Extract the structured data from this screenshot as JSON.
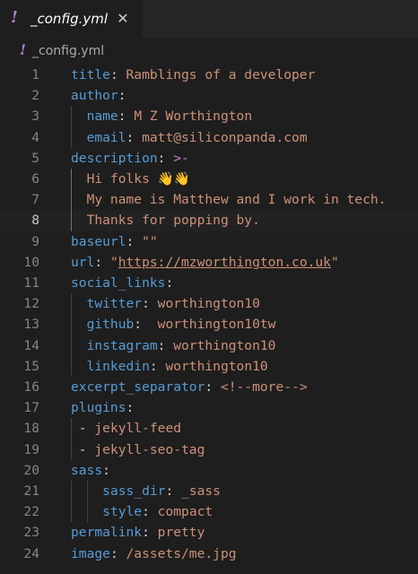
{
  "tab": {
    "icon": "!",
    "title": "_config.yml",
    "close": "✕"
  },
  "breadcrumb": {
    "icon": "!",
    "label": "_config.yml"
  },
  "colors": {
    "key": "#569cd6",
    "string": "#ce9178",
    "plain": "#d4d4d4",
    "operator": "#c586c0",
    "line_number": "#858585",
    "active_line_number": "#c6c6c6",
    "yaml_icon": "#b180d7"
  },
  "editor": {
    "active_line": 8,
    "lines": [
      {
        "num": "1",
        "indent": "",
        "parts": [
          {
            "t": "title",
            "c": "k"
          },
          {
            "t": ": ",
            "c": "p"
          },
          {
            "t": "Ramblings of a developer",
            "c": "s"
          }
        ]
      },
      {
        "num": "2",
        "indent": "",
        "parts": [
          {
            "t": "author",
            "c": "k"
          },
          {
            "t": ":",
            "c": "p"
          }
        ]
      },
      {
        "num": "3",
        "indent": "  ",
        "parts": [
          {
            "t": "name",
            "c": "k"
          },
          {
            "t": ": ",
            "c": "p"
          },
          {
            "t": "M Z Worthington",
            "c": "s"
          }
        ]
      },
      {
        "num": "4",
        "indent": "  ",
        "parts": [
          {
            "t": "email",
            "c": "k"
          },
          {
            "t": ": ",
            "c": "p"
          },
          {
            "t": "matt@siliconpanda.com",
            "c": "s"
          }
        ]
      },
      {
        "num": "5",
        "indent": "",
        "parts": [
          {
            "t": "description",
            "c": "k"
          },
          {
            "t": ": ",
            "c": "p"
          },
          {
            "t": ">-",
            "c": "o"
          }
        ]
      },
      {
        "num": "6",
        "indent": "  ",
        "parts": [
          {
            "t": "Hi folks 👋👋",
            "c": "s"
          }
        ]
      },
      {
        "num": "7",
        "indent": "  ",
        "parts": [
          {
            "t": "My name is Matthew and I work in tech.",
            "c": "s"
          }
        ]
      },
      {
        "num": "8",
        "indent": "  ",
        "parts": [
          {
            "t": "Thanks for popping by.",
            "c": "s"
          }
        ]
      },
      {
        "num": "9",
        "indent": "",
        "parts": [
          {
            "t": "baseurl",
            "c": "k"
          },
          {
            "t": ": ",
            "c": "p"
          },
          {
            "t": "\"\"",
            "c": "s"
          }
        ]
      },
      {
        "num": "10",
        "indent": "",
        "parts": [
          {
            "t": "url",
            "c": "k"
          },
          {
            "t": ": ",
            "c": "p"
          },
          {
            "t": "\"",
            "c": "s"
          },
          {
            "t": "https://mzworthington.co.uk",
            "c": "u"
          },
          {
            "t": "\"",
            "c": "s"
          }
        ]
      },
      {
        "num": "11",
        "indent": "",
        "parts": [
          {
            "t": "social_links",
            "c": "k"
          },
          {
            "t": ":",
            "c": "p"
          }
        ]
      },
      {
        "num": "12",
        "indent": "  ",
        "parts": [
          {
            "t": "twitter",
            "c": "k"
          },
          {
            "t": ": ",
            "c": "p"
          },
          {
            "t": "worthington10",
            "c": "s"
          }
        ]
      },
      {
        "num": "13",
        "indent": "  ",
        "parts": [
          {
            "t": "github",
            "c": "k"
          },
          {
            "t": ":  ",
            "c": "p"
          },
          {
            "t": "worthington10tw",
            "c": "s"
          }
        ]
      },
      {
        "num": "14",
        "indent": "  ",
        "parts": [
          {
            "t": "instagram",
            "c": "k"
          },
          {
            "t": ": ",
            "c": "p"
          },
          {
            "t": "worthington10",
            "c": "s"
          }
        ]
      },
      {
        "num": "15",
        "indent": "  ",
        "parts": [
          {
            "t": "linkedin",
            "c": "k"
          },
          {
            "t": ": ",
            "c": "p"
          },
          {
            "t": "worthington10",
            "c": "s"
          }
        ]
      },
      {
        "num": "16",
        "indent": "",
        "parts": [
          {
            "t": "excerpt_separator",
            "c": "k"
          },
          {
            "t": ": ",
            "c": "p"
          },
          {
            "t": "<!--more-->",
            "c": "s"
          }
        ]
      },
      {
        "num": "17",
        "indent": "",
        "parts": [
          {
            "t": "plugins",
            "c": "k"
          },
          {
            "t": ":",
            "c": "p"
          }
        ]
      },
      {
        "num": "18",
        "indent": " ",
        "parts": [
          {
            "t": "- ",
            "c": "p"
          },
          {
            "t": "jekyll-feed",
            "c": "s"
          }
        ]
      },
      {
        "num": "19",
        "indent": " ",
        "parts": [
          {
            "t": "- ",
            "c": "p"
          },
          {
            "t": "jekyll-seo-tag",
            "c": "s"
          }
        ]
      },
      {
        "num": "20",
        "indent": "",
        "parts": [
          {
            "t": "sass",
            "c": "k"
          },
          {
            "t": ":",
            "c": "p"
          }
        ]
      },
      {
        "num": "21",
        "indent": "    ",
        "parts": [
          {
            "t": "sass_dir",
            "c": "k"
          },
          {
            "t": ": ",
            "c": "p"
          },
          {
            "t": "_sass",
            "c": "s"
          }
        ]
      },
      {
        "num": "22",
        "indent": "    ",
        "parts": [
          {
            "t": "style",
            "c": "k"
          },
          {
            "t": ": ",
            "c": "p"
          },
          {
            "t": "compact",
            "c": "s"
          }
        ]
      },
      {
        "num": "23",
        "indent": "",
        "parts": [
          {
            "t": "permalink",
            "c": "k"
          },
          {
            "t": ": ",
            "c": "p"
          },
          {
            "t": "pretty",
            "c": "s"
          }
        ]
      },
      {
        "num": "24",
        "indent": "",
        "parts": [
          {
            "t": "image",
            "c": "k"
          },
          {
            "t": ": ",
            "c": "p"
          },
          {
            "t": "/assets/me.jpg",
            "c": "s"
          }
        ]
      }
    ]
  }
}
